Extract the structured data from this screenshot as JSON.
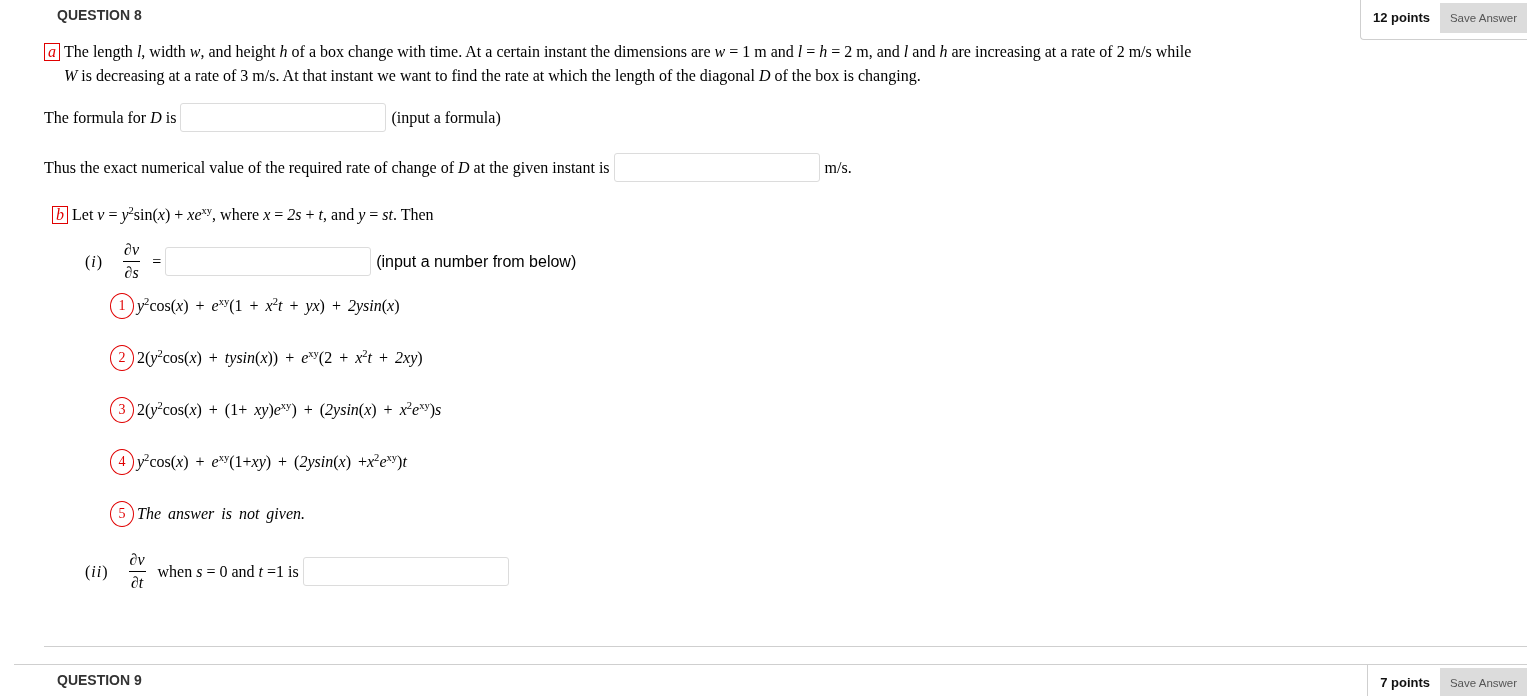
{
  "questions": [
    {
      "title": "QUESTION 8",
      "points": "12 points",
      "save_button": "Save Answer",
      "parts": [
        {
          "label": "a",
          "paragraph": "The length *l*, width *w*, and height *h* of a box change with time. At a certain instant the dimensions are *w* = 1 m and *l* = *h* = 2 m, and *l* and *h* are increasing at a rate of 2 m/s while *W* is decreasing at a rate of 3 m/s. At that instant we want to find the rate at which the length of the diagonal *D* of the box is changing.",
          "answer_lines": [
            {
              "prompt": "The formula for *D* is",
              "suffix": "(input a formula)"
            },
            {
              "prompt": "Thus the exact numerical value of the required rate of change of *D* at the given instant is",
              "suffix": "m/s."
            }
          ]
        },
        {
          "label": "b",
          "paragraph": "Let *v* = *y*$^{2}$sin(*x*) + *xe*$^{xy}$, where *x* = *2s* + *t*, and *y* = *st*. Then",
          "subquestions": [
            {
              "label": "(*i*)",
              "derivative": {
                "numerator": "∂*v*",
                "denominator": "∂*s*"
              },
              "relation": "=",
              "note": "(input a number from below)",
              "options": [
                {
                  "number": "1",
                  "kind": "formula",
                  "text": "*y*$^{2}$cos(*x*) + *e*$^{xy}$(1 + *x*$^{2}$*t* + *yx*) + *2ysin*(*x*)"
                },
                {
                  "number": "2",
                  "kind": "formula",
                  "text": "2(*y*$^{2}$cos(*x*) + *tysin*(*x*)) + *e*$^{xy}$(2 + *x*$^{2}$*t* + *2xy*)"
                },
                {
                  "number": "3",
                  "kind": "formula",
                  "text": "2(*y*$^{2}$cos(*x*) + (1+ *xy*)*e*$^{xy}$) + (*2ysin*(*x*) + *x*$^{2}$*e*$^{xy}$)*s*"
                },
                {
                  "number": "4",
                  "kind": "formula",
                  "text": "*y*$^{2}$cos(*x*) + *e*$^{xy}$(1+*xy*) + (*2ysin*(*x*) +*x*$^{2}$*e*$^{xy}$)*t*"
                },
                {
                  "number": "5",
                  "kind": "statement",
                  "text": "The answer is not given."
                }
              ]
            },
            {
              "label": "(*ii*)",
              "derivative": {
                "numerator": "∂*v*",
                "denominator": "∂*t*"
              },
              "condition": "when *s* = 0 and *t* =1 is"
            }
          ]
        }
      ]
    },
    {
      "title": "QUESTION 9",
      "points": "7 points",
      "save_button": "Save Answer"
    }
  ]
}
